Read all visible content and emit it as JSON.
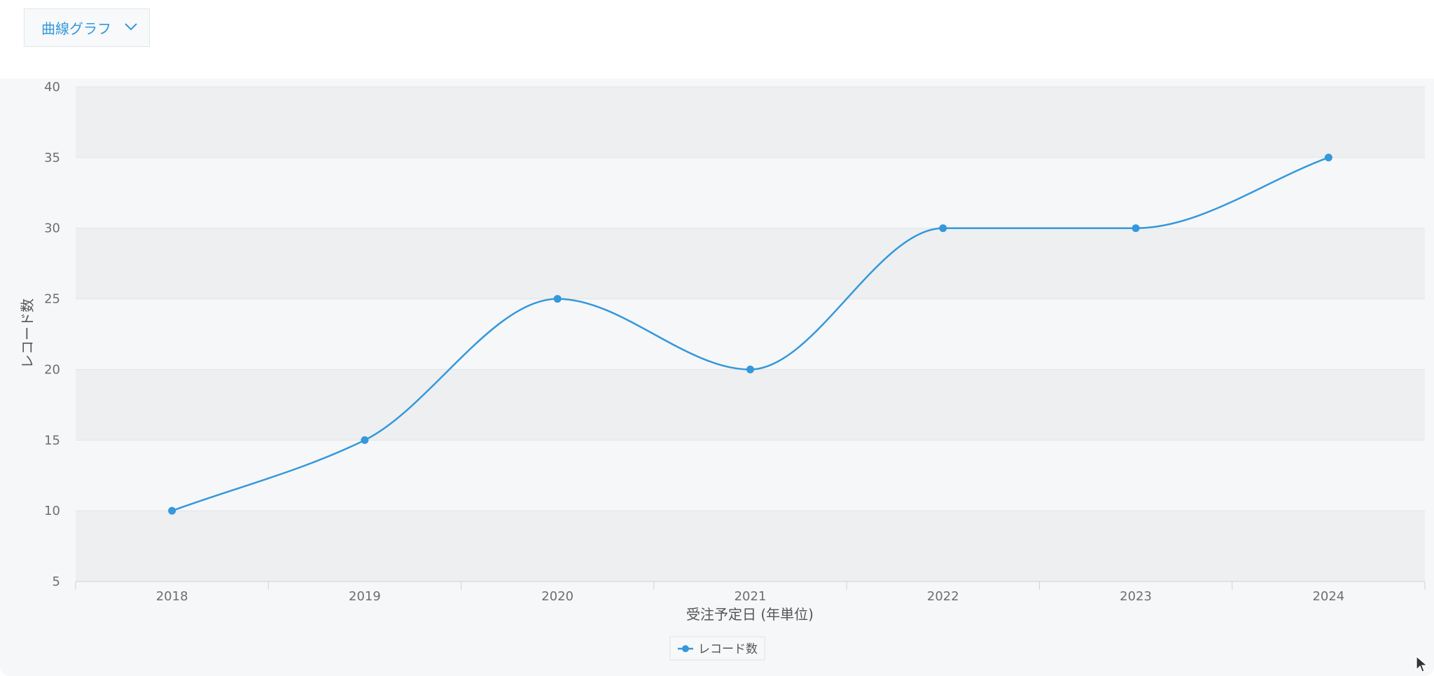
{
  "toolbar": {
    "chart_type_label": "曲線グラフ",
    "chevron_icon": "chevron-down-icon"
  },
  "colors": {
    "series": "#3498db",
    "band_dark": "#eeeff1",
    "band_light": "#f6f7f8"
  },
  "chart_data": {
    "type": "line",
    "curve": "smooth",
    "categories": [
      "2018",
      "2019",
      "2020",
      "2021",
      "2022",
      "2023",
      "2024"
    ],
    "series": [
      {
        "name": "レコード数",
        "values": [
          10,
          15,
          25,
          20,
          30,
          30,
          35
        ]
      }
    ],
    "xlabel": "受注予定日 (年単位)",
    "ylabel": "レコード数",
    "ylim": [
      5,
      40
    ],
    "yticks": [
      5,
      10,
      15,
      20,
      25,
      30,
      35,
      40
    ],
    "grid": true,
    "legend_position": "bottom-center"
  }
}
